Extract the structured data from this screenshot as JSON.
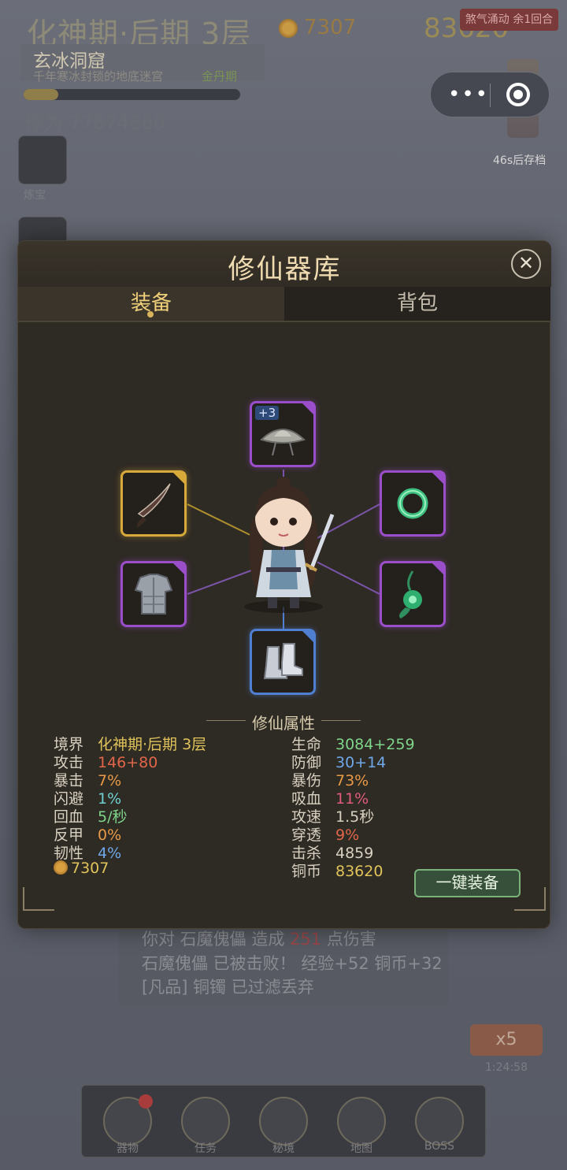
{
  "background": {
    "realm_title": "化神期·后期 3层",
    "coins": "7307",
    "copper": "83620",
    "event_badge": "煞气涌动 余1回合",
    "dungeon": {
      "name": "玄冰洞窟",
      "description": "千年寒冰封锁的地底迷宫",
      "realm": "金丹期"
    },
    "dungeon_progress": 0.16,
    "cultivation": "修为 77874880",
    "side_label": "炼宝",
    "autosave": "46s后存档",
    "log_lines": [
      {
        "prefix": "你对 石魔傀儡 造成 ",
        "damage": "251",
        "suffix": " 点伤害"
      },
      {
        "text": "石魔傀儡 已被击败！ 经验+52 铜币+32"
      },
      {
        "text": "[凡品] 铜镯 已过滤丢弃"
      }
    ],
    "speed": "x5",
    "timer": "1:24:58",
    "nav": [
      "器物",
      "任务",
      "秘境",
      "地图",
      "BOSS"
    ]
  },
  "capsule": {
    "menu_icon": "more-dots-icon",
    "close_icon": "mini-program-close-icon"
  },
  "modal": {
    "title": "修仙器库",
    "close_label": "✕",
    "tabs": [
      {
        "label": "装备",
        "active": true
      },
      {
        "label": "背包",
        "active": false
      }
    ],
    "slots": [
      {
        "name": "helmet",
        "rarity": "purple",
        "icon": "bamboo-hat-icon",
        "enhance": "+3"
      },
      {
        "name": "weapon",
        "rarity": "gold",
        "icon": "blade-icon"
      },
      {
        "name": "ring",
        "rarity": "purple",
        "icon": "jade-ring-icon"
      },
      {
        "name": "armor",
        "rarity": "purple",
        "icon": "armor-icon"
      },
      {
        "name": "pendant",
        "rarity": "purple",
        "icon": "jade-pendant-icon"
      },
      {
        "name": "boots",
        "rarity": "blue",
        "icon": "boots-icon"
      }
    ],
    "attributes": {
      "title": "修仙属性",
      "left": [
        {
          "label": "境界",
          "value": "化神期·后期 3层",
          "color": "gold"
        },
        {
          "label": "攻击",
          "value": "146+80",
          "color": "red"
        },
        {
          "label": "暴击",
          "value": "7%",
          "color": "orange"
        },
        {
          "label": "闪避",
          "value": "1%",
          "color": "cyan"
        },
        {
          "label": "回血",
          "value": "5/秒",
          "color": "green"
        },
        {
          "label": "反甲",
          "value": "0%",
          "color": "orange"
        },
        {
          "label": "韧性",
          "value": "4%",
          "color": "blue"
        }
      ],
      "right": [
        {
          "label": "生命",
          "value": "3084+259",
          "color": "green"
        },
        {
          "label": "防御",
          "value": "30+14",
          "color": "blue"
        },
        {
          "label": "暴伤",
          "value": "73%",
          "color": "orange"
        },
        {
          "label": "吸血",
          "value": "11%",
          "color": "pink"
        },
        {
          "label": "攻速",
          "value": "1.5秒",
          "color": "white"
        },
        {
          "label": "穿透",
          "value": "9%",
          "color": "red"
        },
        {
          "label": "击杀",
          "value": "4859",
          "color": "white"
        },
        {
          "label": "铜币",
          "value": "83620",
          "color": "gold"
        }
      ],
      "coins": "7307"
    },
    "equip_all_label": "一键装备"
  }
}
